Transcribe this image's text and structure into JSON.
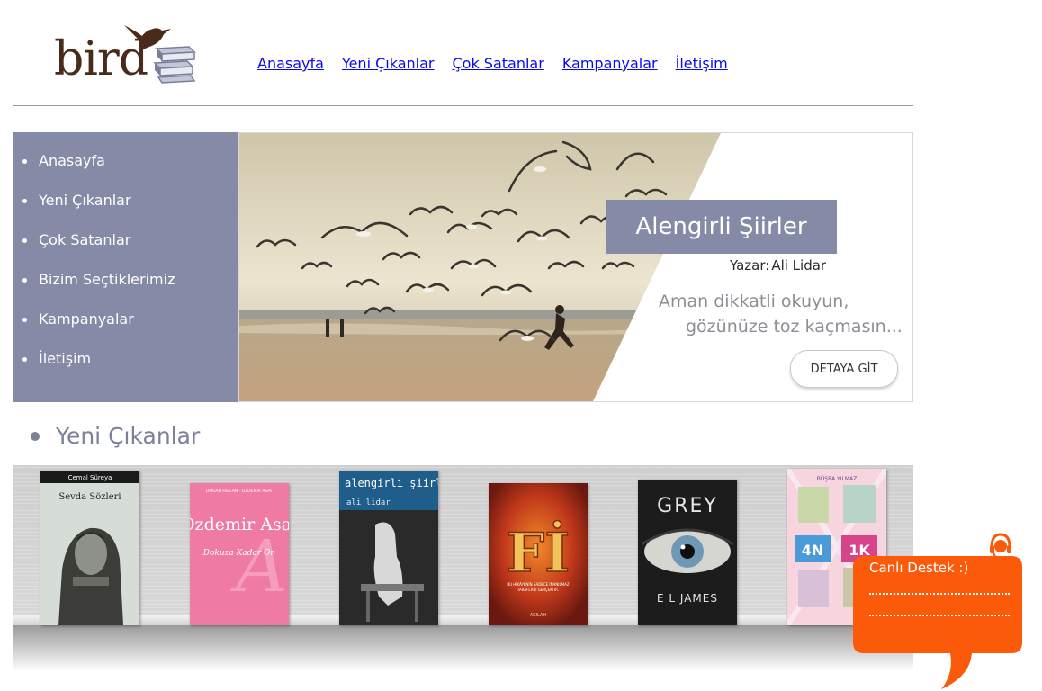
{
  "header": {
    "logo_text": "bird",
    "nav": [
      "Anasayfa",
      "Yeni Çıkanlar",
      "Çok Satanlar",
      "Kampanyalar",
      "İletişim"
    ]
  },
  "sidebar": {
    "items": [
      "Anasayfa",
      "Yeni Çıkanlar",
      "Çok Satanlar",
      "Bizim Seçtiklerimiz",
      "Kampanyalar",
      "İletişim"
    ]
  },
  "hero": {
    "title": "Alengirli Şiirler",
    "author_label": "Yazar:",
    "author_name": "Ali Lidar",
    "line1": "Aman dikkatli okuyun,",
    "line2": "gözünüze toz kaçmasın...",
    "button": "DETAYA GİT"
  },
  "new_releases": {
    "title": "Yeni Çıkanlar",
    "books": [
      {
        "author": "Cemal Süreya",
        "title": "Sevda Sözleri"
      },
      {
        "author": "DOĞAN HIZLAN · ÖZDEMİR ASAF",
        "title": "Özdemir Asaf",
        "subtitle": "Dokuza Kadar On"
      },
      {
        "title": "alengirli şiirler",
        "author": "ali lidar"
      },
      {
        "title": "Fİ",
        "tagline": "BU HİKÂYENİN SADECE İNANILMAZ TARAFLARI GERÇEKTİR.",
        "author": "AKILAH"
      },
      {
        "title": "GREY",
        "author": "E L JAMES"
      },
      {
        "author": "BÜŞRA YILMAZ",
        "title_a": "4N",
        "title_b": "1K"
      }
    ]
  },
  "chat": {
    "label": "Canlı Destek :)"
  },
  "colors": {
    "sidebar_bg": "#858aa6",
    "nav_link": "#0a0aef",
    "chat_bg": "#fb5a0a",
    "heading": "#7c8198"
  }
}
